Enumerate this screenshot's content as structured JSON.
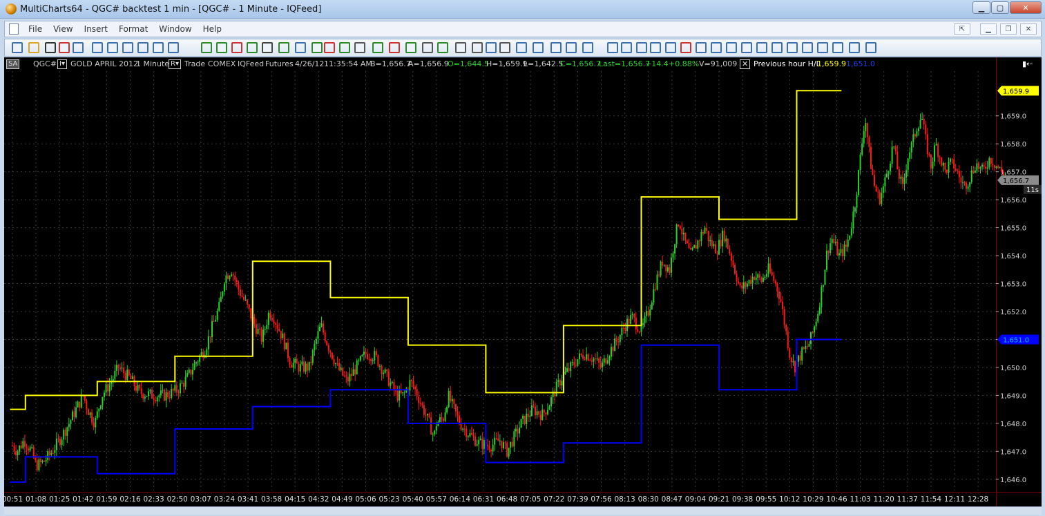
{
  "window": {
    "title": "MultiCharts64 - QGC# backtest 1 min - [QGC# - 1 Minute - IQFeed]"
  },
  "menu": [
    "File",
    "View",
    "Insert",
    "Format",
    "Window",
    "Help"
  ],
  "infobar": {
    "sa": "SA",
    "symbol": "QGC#",
    "desc": "GOLD APRIL 2012",
    "resolution": "1 Minute",
    "mode": "Trade",
    "exchange": "COMEX",
    "feed": "IQFeed",
    "category": "Futures",
    "date": "4/26/12",
    "time": "11:35:54 AM",
    "bid": "B=1,656.7",
    "ask": "A=1,656.9",
    "open": "O=1,644.5",
    "high": "H=1,659.9",
    "low": "L=1,642.5",
    "close": "C=1,656.7",
    "last": "Last=1,656.7",
    "change": "+14.4",
    "pct": "+0.88%",
    "volume": "V=91,009",
    "study": "Previous hour H/L",
    "study_high": "1,659.9",
    "study_low": "1,651.0"
  },
  "colors": {
    "up": "#27d32a",
    "down": "#ff1a1a",
    "high_line": "#ffff00",
    "low_line": "#0000ff",
    "grid": "#3a3a3a",
    "last_tag": "#8c8c8c"
  },
  "chart_data": {
    "type": "candlestick",
    "ylim": [
      1645.6,
      1660.6
    ],
    "y_ticks": [
      1646.0,
      1647.0,
      1648.0,
      1649.0,
      1650.0,
      1651.0,
      1652.0,
      1653.0,
      1654.0,
      1655.0,
      1656.0,
      1657.0,
      1658.0,
      1659.0
    ],
    "y_tick_labels": [
      "1,646.0",
      "1,647.0",
      "1,648.0",
      "1,649.0",
      "1,650.0",
      "1,651.0",
      "1,652.0",
      "1,653.0",
      "1,654.0",
      "1,655.0",
      "1,656.0",
      "1,657.0",
      "1,658.0",
      "1,659.0"
    ],
    "x_ticks": [
      "00:51",
      "01:08",
      "01:25",
      "01:42",
      "01:59",
      "02:16",
      "02:33",
      "02:50",
      "03:07",
      "03:24",
      "03:41",
      "03:58",
      "04:15",
      "04:32",
      "04:49",
      "05:06",
      "05:23",
      "05:40",
      "05:57",
      "06:14",
      "06:31",
      "06:48",
      "07:05",
      "07:22",
      "07:39",
      "07:56",
      "08:13",
      "08:30",
      "08:47",
      "09:04",
      "09:21",
      "09:38",
      "09:55",
      "10:12",
      "10:29",
      "10:46",
      "11:03",
      "11:20",
      "11:37",
      "11:54",
      "12:11",
      "12:28"
    ],
    "price_path": [
      [
        0,
        1647.2
      ],
      [
        0.2,
        1647.0
      ],
      [
        0.5,
        1647.4
      ],
      [
        0.8,
        1647.0
      ],
      [
        1.0,
        1646.5
      ],
      [
        1.3,
        1646.6
      ],
      [
        1.6,
        1646.9
      ],
      [
        2.0,
        1647.4
      ],
      [
        2.4,
        1648.0
      ],
      [
        2.7,
        1648.5
      ],
      [
        3.0,
        1649.0
      ],
      [
        3.2,
        1648.5
      ],
      [
        3.5,
        1648.0
      ],
      [
        3.8,
        1649.0
      ],
      [
        4.2,
        1649.5
      ],
      [
        4.5,
        1650.0
      ],
      [
        5.0,
        1649.6
      ],
      [
        5.4,
        1649.1
      ],
      [
        6.0,
        1649.0
      ],
      [
        6.5,
        1649.0
      ],
      [
        7.0,
        1649.2
      ],
      [
        7.4,
        1649.6
      ],
      [
        7.8,
        1650.2
      ],
      [
        8.2,
        1650.7
      ],
      [
        8.5,
        1651.5
      ],
      [
        8.8,
        1652.2
      ],
      [
        9.0,
        1653.2
      ],
      [
        9.3,
        1653.5
      ],
      [
        9.6,
        1652.8
      ],
      [
        9.9,
        1652.3
      ],
      [
        10.3,
        1651.5
      ],
      [
        10.6,
        1651.0
      ],
      [
        10.9,
        1652.0
      ],
      [
        11.1,
        1651.8
      ],
      [
        11.5,
        1651.0
      ],
      [
        11.8,
        1650.2
      ],
      [
        12.2,
        1650.0
      ],
      [
        12.6,
        1650.0
      ],
      [
        12.9,
        1651.0
      ],
      [
        13.1,
        1651.5
      ],
      [
        13.4,
        1650.8
      ],
      [
        13.8,
        1650.0
      ],
      [
        14.2,
        1649.5
      ],
      [
        14.6,
        1650.0
      ],
      [
        15.0,
        1650.5
      ],
      [
        15.4,
        1650.4
      ],
      [
        15.8,
        1649.8
      ],
      [
        16.0,
        1649.5
      ],
      [
        16.3,
        1649.0
      ],
      [
        16.6,
        1649.0
      ],
      [
        16.9,
        1649.5
      ],
      [
        17.1,
        1649.2
      ],
      [
        17.4,
        1648.6
      ],
      [
        17.7,
        1648.0
      ],
      [
        17.9,
        1647.5
      ],
      [
        18.0,
        1648.0
      ],
      [
        18.3,
        1648.2
      ],
      [
        18.5,
        1649.0
      ],
      [
        18.7,
        1648.6
      ],
      [
        19.0,
        1648.0
      ],
      [
        19.4,
        1647.6
      ],
      [
        19.8,
        1647.3
      ],
      [
        20.3,
        1647.2
      ],
      [
        20.7,
        1647.4
      ],
      [
        21.0,
        1647.0
      ],
      [
        21.3,
        1647.5
      ],
      [
        21.6,
        1648.0
      ],
      [
        21.9,
        1648.3
      ],
      [
        22.1,
        1648.5
      ],
      [
        22.5,
        1648.3
      ],
      [
        22.8,
        1648.7
      ],
      [
        23.0,
        1649.1
      ],
      [
        23.3,
        1649.6
      ],
      [
        23.7,
        1650.0
      ],
      [
        24.0,
        1650.3
      ],
      [
        24.3,
        1650.5
      ],
      [
        24.7,
        1650.3
      ],
      [
        25.0,
        1650.0
      ],
      [
        25.3,
        1650.5
      ],
      [
        25.7,
        1651.0
      ],
      [
        26.0,
        1651.5
      ],
      [
        26.3,
        1651.8
      ],
      [
        26.7,
        1651.3
      ],
      [
        27.0,
        1652.0
      ],
      [
        27.3,
        1653.0
      ],
      [
        27.6,
        1653.8
      ],
      [
        27.9,
        1653.5
      ],
      [
        28.1,
        1654.5
      ],
      [
        28.3,
        1655.3
      ],
      [
        28.5,
        1654.6
      ],
      [
        28.8,
        1654.0
      ],
      [
        29.1,
        1654.5
      ],
      [
        29.4,
        1655.0
      ],
      [
        29.6,
        1654.5
      ],
      [
        29.9,
        1654.2
      ],
      [
        30.2,
        1654.8
      ],
      [
        30.5,
        1654.0
      ],
      [
        30.7,
        1653.4
      ],
      [
        30.9,
        1652.8
      ],
      [
        31.2,
        1653.0
      ],
      [
        31.5,
        1653.3
      ],
      [
        31.8,
        1653.1
      ],
      [
        32.1,
        1653.5
      ],
      [
        32.4,
        1653.0
      ],
      [
        32.6,
        1652.5
      ],
      [
        32.8,
        1651.5
      ],
      [
        33.0,
        1650.5
      ],
      [
        33.2,
        1650.0
      ],
      [
        33.5,
        1650.5
      ],
      [
        33.8,
        1650.8
      ],
      [
        34.0,
        1651.3
      ],
      [
        34.2,
        1652.0
      ],
      [
        34.4,
        1653.0
      ],
      [
        34.6,
        1654.2
      ],
      [
        34.8,
        1654.6
      ],
      [
        35.1,
        1654.0
      ],
      [
        35.4,
        1654.3
      ],
      [
        35.6,
        1655.0
      ],
      [
        35.8,
        1656.0
      ],
      [
        36.0,
        1657.5
      ],
      [
        36.2,
        1659.0
      ],
      [
        36.4,
        1657.5
      ],
      [
        36.6,
        1656.5
      ],
      [
        36.8,
        1656.0
      ],
      [
        37.0,
        1656.5
      ],
      [
        37.2,
        1657.2
      ],
      [
        37.4,
        1658.0
      ],
      [
        37.6,
        1657.0
      ],
      [
        37.8,
        1656.4
      ],
      [
        38.0,
        1657.5
      ],
      [
        38.2,
        1658.0
      ],
      [
        38.4,
        1658.6
      ],
      [
        38.6,
        1659.0
      ],
      [
        38.8,
        1658.0
      ],
      [
        39.0,
        1657.2
      ],
      [
        39.2,
        1658.0
      ],
      [
        39.4,
        1657.5
      ],
      [
        39.6,
        1657.0
      ],
      [
        39.8,
        1657.3
      ],
      [
        40.0,
        1657.2
      ],
      [
        40.2,
        1656.8
      ],
      [
        40.4,
        1656.5
      ],
      [
        40.6,
        1656.7
      ],
      [
        40.9,
        1657.3
      ],
      [
        41.2,
        1657.0
      ],
      [
        41.5,
        1657.5
      ],
      [
        41.8,
        1657.2
      ],
      [
        42.0,
        1657.0
      ],
      [
        42.3,
        1656.7
      ]
    ],
    "prev_hour_high": [
      [
        -0.1,
        1648.5
      ],
      [
        0.55,
        1648.5
      ],
      [
        0.55,
        1649.0
      ],
      [
        3.6,
        1649.0
      ],
      [
        3.6,
        1649.5
      ],
      [
        6.9,
        1649.5
      ],
      [
        6.9,
        1650.4
      ],
      [
        10.2,
        1650.4
      ],
      [
        10.2,
        1653.8
      ],
      [
        13.5,
        1653.8
      ],
      [
        13.5,
        1652.5
      ],
      [
        16.8,
        1652.5
      ],
      [
        16.8,
        1650.8
      ],
      [
        20.1,
        1650.8
      ],
      [
        20.1,
        1649.1
      ],
      [
        23.4,
        1649.1
      ],
      [
        23.4,
        1651.5
      ],
      [
        26.7,
        1651.5
      ],
      [
        26.7,
        1656.1
      ],
      [
        30.0,
        1656.1
      ],
      [
        30.0,
        1655.3
      ],
      [
        33.3,
        1655.3
      ],
      [
        33.3,
        1659.9
      ],
      [
        35.2,
        1659.9
      ]
    ],
    "prev_hour_low": [
      [
        -0.1,
        1645.9
      ],
      [
        0.55,
        1645.9
      ],
      [
        0.55,
        1646.8
      ],
      [
        3.6,
        1646.8
      ],
      [
        3.6,
        1646.2
      ],
      [
        6.9,
        1646.2
      ],
      [
        6.9,
        1647.8
      ],
      [
        10.2,
        1647.8
      ],
      [
        10.2,
        1648.6
      ],
      [
        13.5,
        1648.6
      ],
      [
        13.5,
        1649.2
      ],
      [
        16.8,
        1649.2
      ],
      [
        16.8,
        1648.0
      ],
      [
        20.1,
        1648.0
      ],
      [
        20.1,
        1646.6
      ],
      [
        23.4,
        1646.6
      ],
      [
        23.4,
        1647.3
      ],
      [
        26.7,
        1647.3
      ],
      [
        26.7,
        1650.8
      ],
      [
        30.0,
        1650.8
      ],
      [
        30.0,
        1649.2
      ],
      [
        33.3,
        1649.2
      ],
      [
        33.3,
        1651.0
      ],
      [
        35.2,
        1651.0
      ]
    ],
    "last_price": "1,656.7",
    "timer": "11s"
  }
}
